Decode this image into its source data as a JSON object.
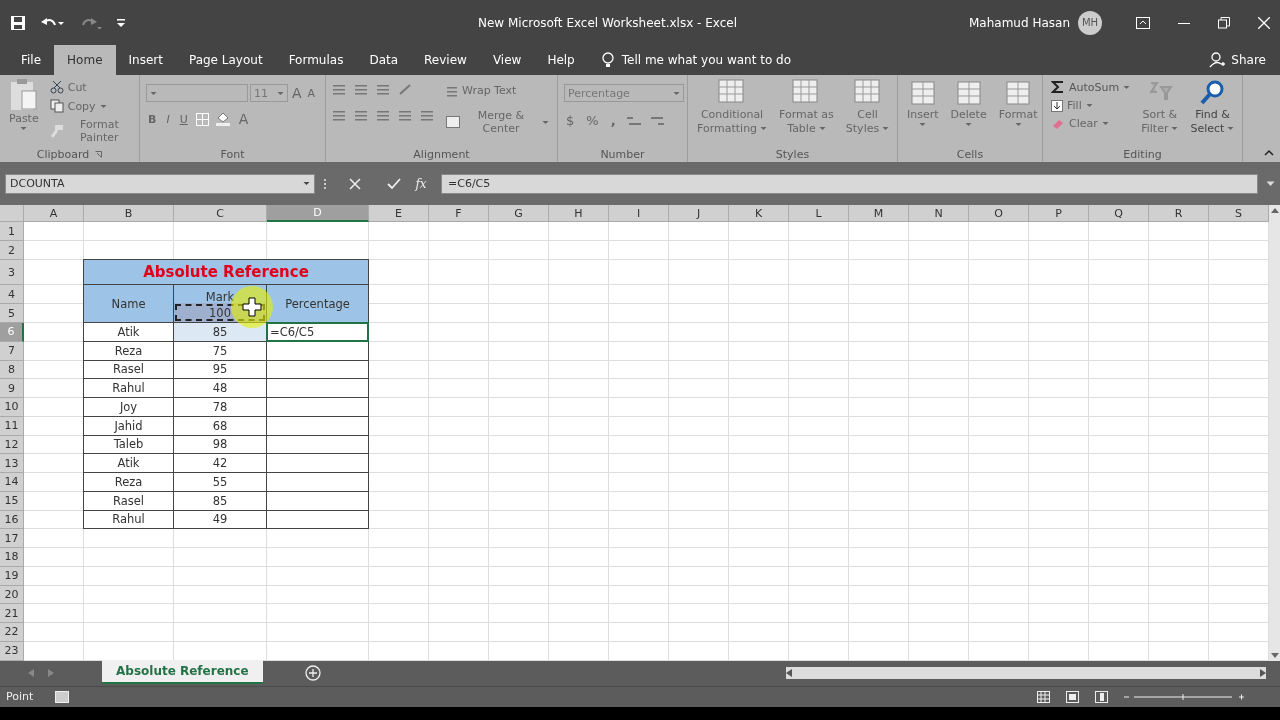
{
  "window": {
    "title": "New Microsoft Excel Worksheet.xlsx  -  Excel",
    "user": "Mahamud Hasan",
    "initials": "MH"
  },
  "ribbon_tabs": [
    {
      "label": "File",
      "selected": false
    },
    {
      "label": "Home",
      "selected": true
    },
    {
      "label": "Insert",
      "selected": false
    },
    {
      "label": "Page Layout",
      "selected": false
    },
    {
      "label": "Formulas",
      "selected": false
    },
    {
      "label": "Data",
      "selected": false
    },
    {
      "label": "Review",
      "selected": false
    },
    {
      "label": "View",
      "selected": false
    },
    {
      "label": "Help",
      "selected": false
    }
  ],
  "tell_me": "Tell me what you want to do",
  "share": "Share",
  "clipboard": {
    "label": "Clipboard",
    "paste": "Paste",
    "cut": "Cut",
    "copy": "Copy",
    "format_painter": "Format Painter"
  },
  "font": {
    "label": "Font",
    "size": "11",
    "grow": "A",
    "shrink": "A",
    "bold": "B",
    "italic": "I",
    "underline": "U",
    "color_letter": "A"
  },
  "alignment": {
    "label": "Alignment",
    "wrap": "Wrap Text",
    "merge": "Merge & Center"
  },
  "number": {
    "label": "Number",
    "format": "Percentage",
    "currency": "$",
    "percent": "%",
    "comma": ","
  },
  "styles": {
    "label": "Styles",
    "buttons": [
      [
        "Conditional",
        "Formatting"
      ],
      [
        "Format as",
        "Table"
      ],
      [
        "Cell",
        "Styles"
      ]
    ]
  },
  "cells": {
    "label": "Cells",
    "buttons": [
      "Insert",
      "Delete",
      "Format"
    ]
  },
  "editing": {
    "label": "Editing",
    "autosum": "AutoSum",
    "fill": "Fill",
    "clear": "Clear",
    "sort": [
      "Sort &",
      "Filter"
    ],
    "find": [
      "Find &",
      "Select"
    ]
  },
  "name_box": "DCOUNTA",
  "fx": "fx",
  "formula": "=C6/C5",
  "columns": [
    {
      "label": "A",
      "selected": false
    },
    {
      "label": "B",
      "selected": false
    },
    {
      "label": "C",
      "selected": false
    },
    {
      "label": "D",
      "selected": true
    },
    {
      "label": "E",
      "selected": false
    },
    {
      "label": "F",
      "selected": false
    },
    {
      "label": "G",
      "selected": false
    },
    {
      "label": "H",
      "selected": false
    },
    {
      "label": "I",
      "selected": false
    },
    {
      "label": "J",
      "selected": false
    },
    {
      "label": "K",
      "selected": false
    },
    {
      "label": "L",
      "selected": false
    },
    {
      "label": "M",
      "selected": false
    },
    {
      "label": "N",
      "selected": false
    },
    {
      "label": "O",
      "selected": false
    },
    {
      "label": "P",
      "selected": false
    },
    {
      "label": "Q",
      "selected": false
    },
    {
      "label": "R",
      "selected": false
    },
    {
      "label": "S",
      "selected": false
    }
  ],
  "rows": [
    {
      "label": "1",
      "selected": false
    },
    {
      "label": "2",
      "selected": false
    },
    {
      "label": "3",
      "selected": false
    },
    {
      "label": "4",
      "selected": false
    },
    {
      "label": "5",
      "selected": false
    },
    {
      "label": "6",
      "selected": true
    },
    {
      "label": "7",
      "selected": false
    },
    {
      "label": "8",
      "selected": false
    },
    {
      "label": "9",
      "selected": false
    },
    {
      "label": "10",
      "selected": false
    },
    {
      "label": "11",
      "selected": false
    },
    {
      "label": "12",
      "selected": false
    },
    {
      "label": "13",
      "selected": false
    },
    {
      "label": "14",
      "selected": false
    },
    {
      "label": "15",
      "selected": false
    },
    {
      "label": "16",
      "selected": false
    },
    {
      "label": "17",
      "selected": false
    },
    {
      "label": "18",
      "selected": false
    },
    {
      "label": "19",
      "selected": false
    },
    {
      "label": "20",
      "selected": false
    },
    {
      "label": "21",
      "selected": false
    },
    {
      "label": "22",
      "selected": false
    },
    {
      "label": "23",
      "selected": false
    }
  ],
  "table": {
    "title": "Absolute Reference",
    "name_header": "Name",
    "mark_header": "Mark",
    "max_mark": "100",
    "percentage_header": "Percentage",
    "records": [
      {
        "name": "Atik",
        "mark": "85",
        "percentage": "=C6/C5"
      },
      {
        "name": "Reza",
        "mark": "75"
      },
      {
        "name": "Rasel",
        "mark": "95"
      },
      {
        "name": "Rahul",
        "mark": "48"
      },
      {
        "name": "Joy",
        "mark": "78"
      },
      {
        "name": "Jahid",
        "mark": "68"
      },
      {
        "name": "Taleb",
        "mark": "98"
      },
      {
        "name": "Atik",
        "mark": "42"
      },
      {
        "name": "Reza",
        "mark": "55"
      },
      {
        "name": "Rasel",
        "mark": "85"
      },
      {
        "name": "Rahul",
        "mark": "49"
      }
    ]
  },
  "sheet_tabs": [
    {
      "label": "Absolute Reference",
      "selected": true
    }
  ],
  "status": "Point"
}
